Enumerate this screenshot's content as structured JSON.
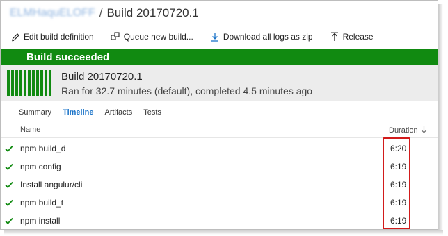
{
  "breadcrumb": {
    "project": "ELMHaquELOFF",
    "separator": "/",
    "build": "Build 20170720.1"
  },
  "toolbar": {
    "edit_label": "Edit build definition",
    "queue_label": "Queue new build...",
    "download_label": "Download all logs as zip",
    "release_label": "Release"
  },
  "banner": {
    "status_text": "Build succeeded",
    "color": "#118a11"
  },
  "summary": {
    "build_name": "Build 20170720.1",
    "subtitle": "Ran for 32.7 minutes (default), completed 4.5 minutes ago",
    "history_bar_count": 11
  },
  "tabs": [
    {
      "label": "Summary",
      "active": false
    },
    {
      "label": "Timeline",
      "active": true
    },
    {
      "label": "Artifacts",
      "active": false
    },
    {
      "label": "Tests",
      "active": false
    }
  ],
  "table": {
    "col_name": "Name",
    "col_duration": "Duration",
    "rows": [
      {
        "name": "npm build_d",
        "duration": "6:20",
        "status": "succeeded"
      },
      {
        "name": "npm config",
        "duration": "6:19",
        "status": "succeeded"
      },
      {
        "name": "Install angulur/cli",
        "duration": "6:19",
        "status": "succeeded"
      },
      {
        "name": "npm build_t",
        "duration": "6:19",
        "status": "succeeded"
      },
      {
        "name": "npm install",
        "duration": "6:19",
        "status": "succeeded"
      }
    ]
  },
  "colors": {
    "success": "#118a11",
    "accent": "#1a73c8",
    "highlight": "#d21b1b"
  }
}
